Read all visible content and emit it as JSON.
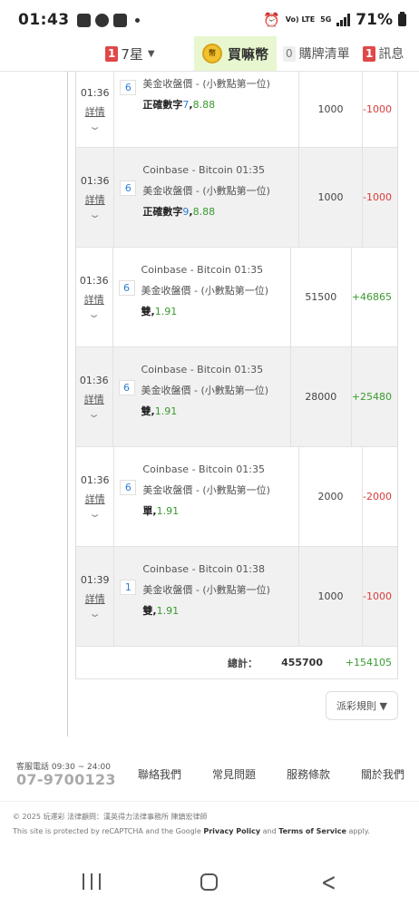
{
  "status_bar": {
    "time": "01:43",
    "battery": "71%",
    "network": "5G",
    "volte": "Vo) LTE"
  },
  "nav": {
    "star_badge": "1",
    "star_label": "7星",
    "coin_label": "買嘛幣",
    "coin_icon_text": "幣",
    "list_badge": "0",
    "list_label": "購牌清單",
    "msg_badge": "1",
    "msg_label": "訊息"
  },
  "bets": [
    {
      "time": "01:36",
      "detail": "詳情",
      "issue_num": "6",
      "issue_title": "",
      "issue_desc": "美金收盤價 - (小數點第一位)",
      "pick_label": "正確數字",
      "pick_value": "7",
      "odds": "8.88",
      "amount": "1000",
      "win": "-1000",
      "win_sign": "neg"
    },
    {
      "time": "01:36",
      "detail": "詳情",
      "issue_num": "6",
      "issue_title": "Coinbase - Bitcoin 01:35",
      "issue_desc": "美金收盤價 - (小數點第一位)",
      "pick_label": "正確數字",
      "pick_value": "9",
      "odds": "8.88",
      "amount": "1000",
      "win": "-1000",
      "win_sign": "neg"
    },
    {
      "time": "01:36",
      "detail": "詳情",
      "issue_num": "6",
      "issue_title": "Coinbase - Bitcoin 01:35",
      "issue_desc": "美金收盤價 - (小數點第一位)",
      "pick_label": "雙",
      "pick_value": "",
      "odds": "1.91",
      "amount": "51500",
      "win": "+46865",
      "win_sign": "pos"
    },
    {
      "time": "01:36",
      "detail": "詳情",
      "issue_num": "6",
      "issue_title": "Coinbase - Bitcoin 01:35",
      "issue_desc": "美金收盤價 - (小數點第一位)",
      "pick_label": "雙",
      "pick_value": "",
      "odds": "1.91",
      "amount": "28000",
      "win": "+25480",
      "win_sign": "pos"
    },
    {
      "time": "01:36",
      "detail": "詳情",
      "issue_num": "6",
      "issue_title": "Coinbase - Bitcoin 01:35",
      "issue_desc": "美金收盤價 - (小數點第一位)",
      "pick_label": "單",
      "pick_value": "",
      "odds": "1.91",
      "amount": "2000",
      "win": "-2000",
      "win_sign": "neg"
    },
    {
      "time": "01:39",
      "detail": "詳情",
      "issue_num": "1",
      "issue_title": "Coinbase - Bitcoin 01:38",
      "issue_desc": "美金收盤價 - (小數點第一位)",
      "pick_label": "雙",
      "pick_value": "",
      "odds": "1.91",
      "amount": "1000",
      "win": "-1000",
      "win_sign": "neg"
    }
  ],
  "total": {
    "label": "總計：",
    "amount": "455700",
    "win": "+154105"
  },
  "rules_button": "派彩規則 ▼",
  "footer": {
    "hotline_label": "客服電話 09:30 ~ 24:00",
    "hotline": "07-9700123",
    "links": [
      "聯絡我們",
      "常見問題",
      "服務條款",
      "關於我們"
    ],
    "copyright": "© 2025 玩運彩 法律顧問：漢英得力法律事務所 陳鎮宏律師",
    "recaptcha_pre": "This site is protected by reCAPTCHA and the Google ",
    "privacy": "Privacy Policy",
    "and": " and ",
    "terms": "Terms of Service",
    "apply": " apply."
  },
  "colors": {
    "negative": "#d93a3a",
    "positive": "#3a9a2e",
    "issue_blue": "#2c7dd6",
    "coin_bg": "#e8f7cf",
    "badge_red": "#e04848"
  }
}
